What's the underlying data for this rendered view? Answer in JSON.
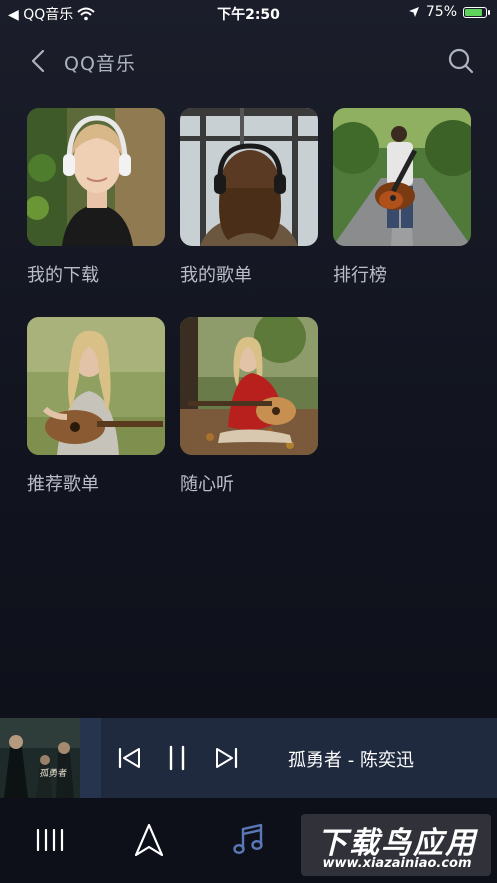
{
  "status_bar": {
    "carrier": "◀ QQ音乐",
    "time": "下午2:50",
    "battery_level": "75%",
    "battery_fraction": 0.75
  },
  "header": {
    "title": "QQ音乐",
    "back_icon": "chevron-left-icon",
    "search_icon": "search-icon"
  },
  "grid_items": [
    {
      "label": "我的下载"
    },
    {
      "label": "我的歌单"
    },
    {
      "label": "排行榜"
    },
    {
      "label": "推荐歌单"
    },
    {
      "label": "随心听"
    }
  ],
  "player": {
    "song": "孤勇者 - 陈奕迅",
    "cover_text": "孤勇者",
    "controls": [
      "previous-icon",
      "pause-icon",
      "next-icon"
    ]
  },
  "nav": {
    "items": [
      "equalizer-icon",
      "navigation-icon",
      "music-note-icon"
    ],
    "active": "music-note-icon"
  },
  "watermark": {
    "line1": "下载鸟应用",
    "line2": "www.xiazainiao.com"
  },
  "colors": {
    "background": "#121520",
    "player_bar": "#1f2a3e",
    "active_nav": "#5a78b8",
    "text": "#b9bdc8"
  }
}
